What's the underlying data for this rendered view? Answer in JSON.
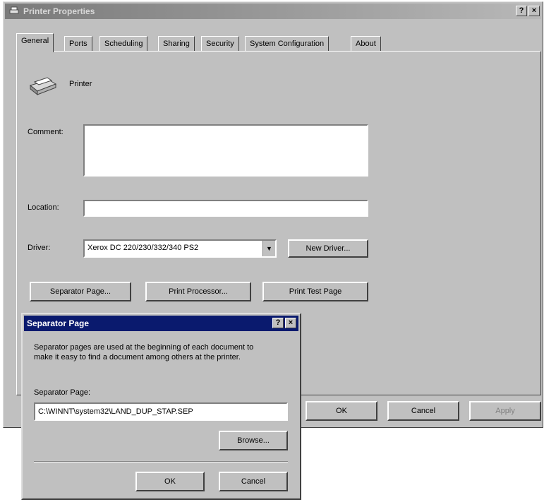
{
  "window": {
    "title": "Printer Properties",
    "help_glyph": "?",
    "close_glyph": "×"
  },
  "tabs": [
    {
      "label": "General"
    },
    {
      "label": "Ports"
    },
    {
      "label": "Scheduling"
    },
    {
      "label": "Sharing"
    },
    {
      "label": "Security"
    },
    {
      "label": "System Configuration"
    },
    {
      "label": "About"
    }
  ],
  "general": {
    "printer_name": "Printer",
    "comment_label": "Comment:",
    "comment_value": "",
    "location_label": "Location:",
    "location_value": "",
    "driver_label": "Driver:",
    "driver_value": "Xerox DC 220/230/332/340 PS2",
    "new_driver_button": "New Driver...",
    "separator_page_button": "Separator Page...",
    "print_processor_button": "Print Processor...",
    "print_test_page_button": "Print Test Page"
  },
  "footer": {
    "ok": "OK",
    "cancel": "Cancel",
    "apply": "Apply"
  },
  "separator_dialog": {
    "title": "Separator Page",
    "description": "Separator pages are used at the beginning of each document to make it easy to find a document among others at the printer.",
    "field_label": "Separator Page:",
    "field_value": "C:\\WINNT\\system32\\LAND_DUP_STAP.SEP",
    "browse_button": "Browse...",
    "ok": "OK",
    "cancel": "Cancel",
    "help_glyph": "?",
    "close_glyph": "×"
  }
}
